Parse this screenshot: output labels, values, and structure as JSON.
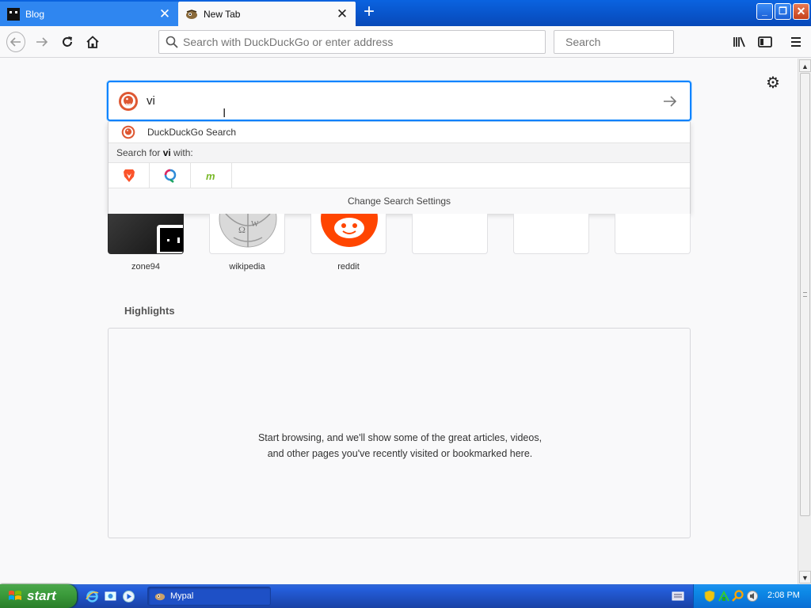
{
  "tabs": [
    {
      "title": "Blog",
      "active": false
    },
    {
      "title": "New Tab",
      "active": true
    }
  ],
  "navbar": {
    "url_placeholder": "Search with DuckDuckGo or enter address",
    "search_placeholder": "Search"
  },
  "newtab": {
    "search_value": "vi",
    "dropdown": {
      "engine_label": "DuckDuckGo Search",
      "search_for_prefix": "Search for ",
      "search_for_term": "vi",
      "search_for_suffix": " with:",
      "engines": [
        "brave-icon",
        "qwant-icon",
        "mojeek-icon"
      ],
      "change_settings": "Change Search Settings"
    },
    "top_sites": [
      {
        "label": "zone94"
      },
      {
        "label": "wikipedia"
      },
      {
        "label": "reddit"
      }
    ],
    "highlights": {
      "title": "Highlights",
      "empty_message": "Start browsing, and we'll show some of the great articles, videos, and other pages you've recently visited or bookmarked here."
    }
  },
  "taskbar": {
    "start_label": "start",
    "task_label": "Mypal",
    "clock": "2:08 PM"
  },
  "colors": {
    "accent": "#0a84ff",
    "titlebar": "#0a63e0",
    "start_green": "#3c9c3c"
  }
}
